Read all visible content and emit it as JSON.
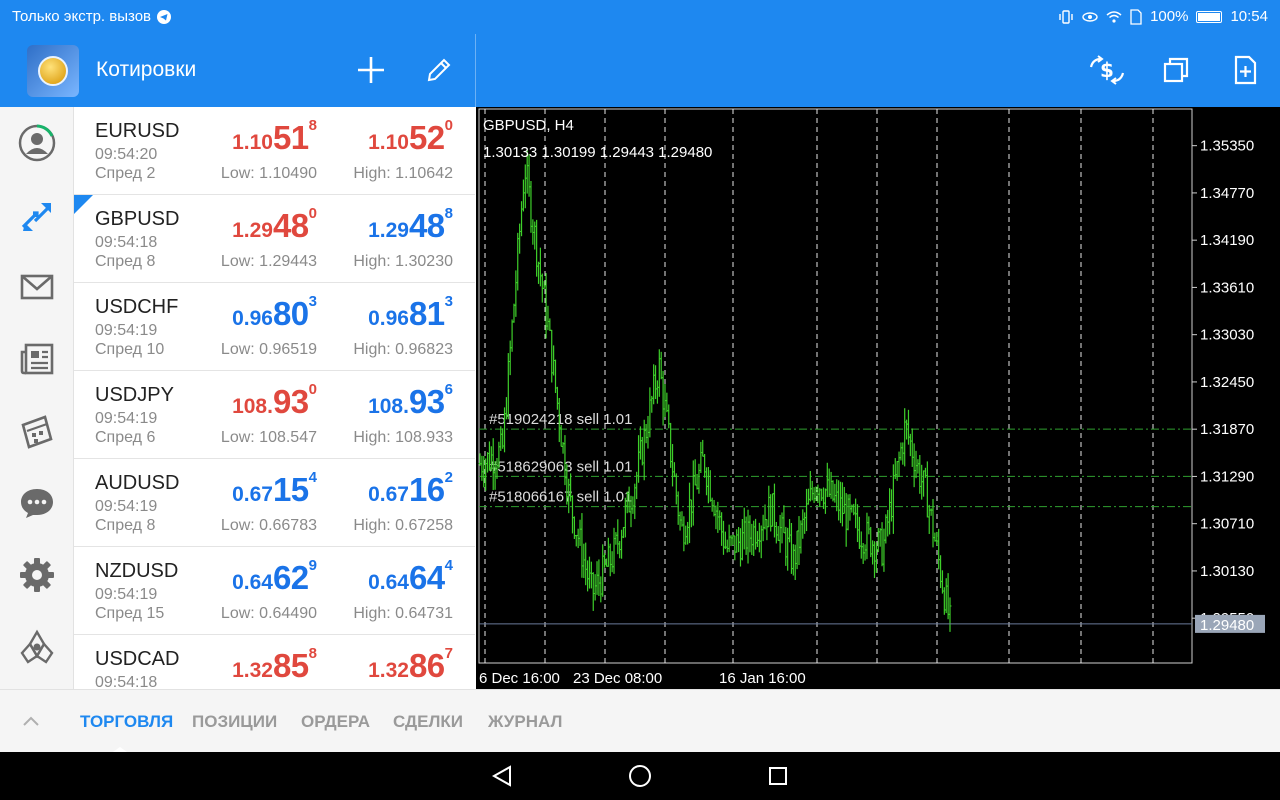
{
  "status_bar": {
    "carrier": "Только экстр. вызов",
    "battery": "100%",
    "time": "10:54"
  },
  "header": {
    "title": "Котировки",
    "icons": [
      "plus-icon",
      "pencil-icon",
      "trade-icon",
      "windows-icon",
      "new-document-icon"
    ]
  },
  "sidebar": {
    "items": [
      "account-icon",
      "trade-arrows-icon",
      "mail-icon",
      "news-icon",
      "calendar-icon",
      "chat-icon",
      "settings-icon",
      "community-icon"
    ]
  },
  "quotes": [
    {
      "symbol": "EURUSD",
      "time": "09:54:20",
      "spread": "Спред 2",
      "bid_pre": "1.10",
      "bid_big": "51",
      "bid_sup": "8",
      "ask_pre": "1.10",
      "ask_big": "52",
      "ask_sup": "0",
      "low": "Low: 1.10490",
      "high": "High: 1.10642",
      "dir": "down"
    },
    {
      "symbol": "GBPUSD",
      "time": "09:54:18",
      "spread": "Спред 8",
      "bid_pre": "1.29",
      "bid_big": "48",
      "bid_sup": "0",
      "ask_pre": "1.29",
      "ask_big": "48",
      "ask_sup": "8",
      "low": "Low: 1.29443",
      "high": "High: 1.30230",
      "dir": "mixed"
    },
    {
      "symbol": "USDCHF",
      "time": "09:54:19",
      "spread": "Спред 10",
      "bid_pre": "0.96",
      "bid_big": "80",
      "bid_sup": "3",
      "ask_pre": "0.96",
      "ask_big": "81",
      "ask_sup": "3",
      "low": "Low: 0.96519",
      "high": "High: 0.96823",
      "dir": "up"
    },
    {
      "symbol": "USDJPY",
      "time": "09:54:19",
      "spread": "Спред 6",
      "bid_pre": "108.",
      "bid_big": "93",
      "bid_sup": "0",
      "ask_pre": "108.",
      "ask_big": "93",
      "ask_sup": "6",
      "low": "Low: 108.547",
      "high": "High: 108.933",
      "dir": "mixed"
    },
    {
      "symbol": "AUDUSD",
      "time": "09:54:19",
      "spread": "Спред 8",
      "bid_pre": "0.67",
      "bid_big": "15",
      "bid_sup": "4",
      "ask_pre": "0.67",
      "ask_big": "16",
      "ask_sup": "2",
      "low": "Low: 0.66783",
      "high": "High: 0.67258",
      "dir": "up"
    },
    {
      "symbol": "NZDUSD",
      "time": "09:54:19",
      "spread": "Спред 15",
      "bid_pre": "0.64",
      "bid_big": "62",
      "bid_sup": "9",
      "ask_pre": "0.64",
      "ask_big": "64",
      "ask_sup": "4",
      "low": "Low: 0.64490",
      "high": "High: 0.64731",
      "dir": "up"
    },
    {
      "symbol": "USDCAD",
      "time": "09:54:18",
      "spread": "",
      "bid_pre": "1.32",
      "bid_big": "85",
      "bid_sup": "8",
      "ask_pre": "1.32",
      "ask_big": "86",
      "ask_sup": "7",
      "low": "",
      "high": "",
      "dir": "down"
    }
  ],
  "chart": {
    "title": "GBPUSD, H4",
    "ohlc": "1.30133 1.30199 1.29443 1.29480",
    "orders": [
      "#519024218 sell 1.01",
      "#518629063 sell 1.01",
      "#518066167 sell 1.01"
    ],
    "current_price": "1.29480",
    "y_ticks": [
      "1.35350",
      "1.34770",
      "1.34190",
      "1.33610",
      "1.33030",
      "1.32450",
      "1.31870",
      "1.31290",
      "1.30710",
      "1.30130",
      "1.29550"
    ],
    "x_ticks": [
      "6 Dec 16:00",
      "23 Dec 08:00",
      "16 Jan 16:00"
    ],
    "colors": {
      "bars": "#3ecf2a",
      "grid": "#ffffff",
      "order_line": "#2fa02f",
      "price_line": "#6a7a9a",
      "price_tag": "#9aa6b8"
    }
  },
  "chart_data": {
    "type": "line",
    "title": "GBPUSD, H4",
    "ylim": [
      1.29,
      1.358
    ],
    "x": [
      "6 Dec 16:00",
      "23 Dec 08:00",
      "16 Jan 16:00"
    ],
    "series": [
      {
        "values": [
          1.3145,
          1.316,
          1.351,
          1.332,
          1.31,
          1.2985,
          1.3035,
          1.313,
          1.3265,
          1.306,
          1.315,
          1.304,
          1.3055,
          1.309,
          1.3025,
          1.3125,
          1.3095,
          1.306,
          1.304,
          1.319,
          1.31,
          1.2948
        ]
      }
    ],
    "orders": [
      1.3187,
      1.3129,
      1.3092
    ],
    "current": 1.2948
  },
  "bottom_tabs": {
    "collapse_icon": "chevron-up-icon",
    "tabs": [
      "ТОРГОВЛЯ",
      "ПОЗИЦИИ",
      "ОРДЕРА",
      "СДЕЛКИ",
      "ЖУРНАЛ"
    ],
    "active": 0
  },
  "nav": [
    "back-icon",
    "home-icon",
    "recents-icon"
  ]
}
